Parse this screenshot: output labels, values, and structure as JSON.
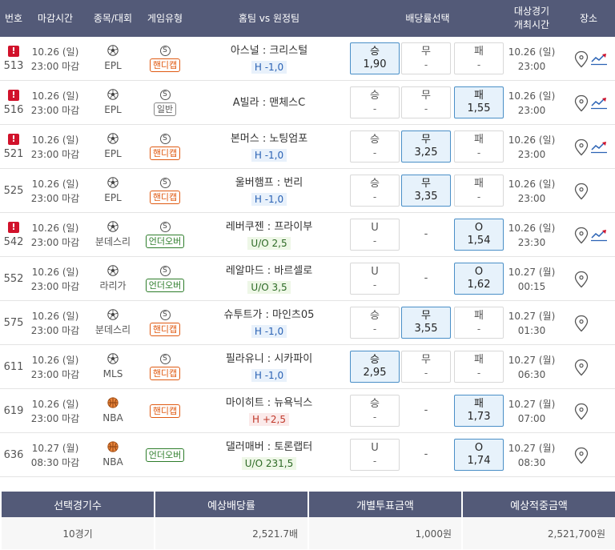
{
  "header": {
    "no": "번호",
    "deadline": "마감시간",
    "sport": "종목/대회",
    "game_type": "게임유형",
    "teams": "홈팀 vs 원정팀",
    "odds": "배당률선택",
    "date_line1": "대상경기",
    "date_line2": "개최시간",
    "place": "장소"
  },
  "rows": [
    {
      "no": "513",
      "alert": "!",
      "deadline1": "10.26 (일)",
      "deadline2": "23:00 마감",
      "sport": "EPL",
      "ball": "soccer",
      "s": "S",
      "tag": "핸디캡",
      "tag_type": "handi",
      "teams": "아스널 : 크리스털",
      "line": "H -1,0",
      "line_type": "h-minus",
      "o1": {
        "l": "승",
        "v": "1,90",
        "sel": true
      },
      "o2": {
        "l": "무",
        "v": "-",
        "sel": false
      },
      "o3": {
        "l": "패",
        "v": "-",
        "sel": false
      },
      "date1": "10.26 (일)",
      "date2": "23:00",
      "trend": true
    },
    {
      "no": "516",
      "alert": "!",
      "deadline1": "10.26 (일)",
      "deadline2": "23:00 마감",
      "sport": "EPL",
      "ball": "soccer",
      "s": "S",
      "tag": "일반",
      "tag_type": "normal",
      "teams": "A빌라 : 맨체스C",
      "line": "",
      "line_type": "",
      "o1": {
        "l": "승",
        "v": "-",
        "sel": false
      },
      "o2": {
        "l": "무",
        "v": "-",
        "sel": false
      },
      "o3": {
        "l": "패",
        "v": "1,55",
        "sel": true
      },
      "date1": "10.26 (일)",
      "date2": "23:00",
      "trend": true
    },
    {
      "no": "521",
      "alert": "!",
      "deadline1": "10.26 (일)",
      "deadline2": "23:00 마감",
      "sport": "EPL",
      "ball": "soccer",
      "s": "S",
      "tag": "핸디캡",
      "tag_type": "handi",
      "teams": "본머스 : 노팅엄포",
      "line": "H -1,0",
      "line_type": "h-minus",
      "o1": {
        "l": "승",
        "v": "-",
        "sel": false
      },
      "o2": {
        "l": "무",
        "v": "3,25",
        "sel": true
      },
      "o3": {
        "l": "패",
        "v": "-",
        "sel": false
      },
      "date1": "10.26 (일)",
      "date2": "23:00",
      "trend": true
    },
    {
      "no": "525",
      "alert": "",
      "deadline1": "10.26 (일)",
      "deadline2": "23:00 마감",
      "sport": "EPL",
      "ball": "soccer",
      "s": "S",
      "tag": "핸디캡",
      "tag_type": "handi",
      "teams": "울버햄프 : 번리",
      "line": "H -1,0",
      "line_type": "h-minus",
      "o1": {
        "l": "승",
        "v": "-",
        "sel": false
      },
      "o2": {
        "l": "무",
        "v": "3,35",
        "sel": true
      },
      "o3": {
        "l": "패",
        "v": "-",
        "sel": false
      },
      "date1": "10.26 (일)",
      "date2": "23:00",
      "trend": false
    },
    {
      "no": "542",
      "alert": "!",
      "deadline1": "10.26 (일)",
      "deadline2": "23:00 마감",
      "sport": "분데스리",
      "ball": "soccer",
      "s": "S",
      "tag": "언더오버",
      "tag_type": "uo",
      "teams": "레버쿠젠 : 프라이부",
      "line": "U/O 2,5",
      "line_type": "uo",
      "o1": {
        "l": "U",
        "v": "-",
        "sel": false
      },
      "o2": {
        "l": "-",
        "v": "",
        "sel": false,
        "blank": true
      },
      "o3": {
        "l": "O",
        "v": "1,54",
        "sel": true
      },
      "date1": "10.26 (일)",
      "date2": "23:30",
      "trend": true
    },
    {
      "no": "552",
      "alert": "",
      "deadline1": "10.26 (일)",
      "deadline2": "23:00 마감",
      "sport": "라리가",
      "ball": "soccer",
      "s": "S",
      "tag": "언더오버",
      "tag_type": "uo",
      "teams": "레알마드 : 바르셀로",
      "line": "U/O 3,5",
      "line_type": "uo",
      "o1": {
        "l": "U",
        "v": "-",
        "sel": false
      },
      "o2": {
        "l": "-",
        "v": "",
        "sel": false,
        "blank": true
      },
      "o3": {
        "l": "O",
        "v": "1,62",
        "sel": true
      },
      "date1": "10.27 (월)",
      "date2": "00:15",
      "trend": false
    },
    {
      "no": "575",
      "alert": "",
      "deadline1": "10.26 (일)",
      "deadline2": "23:00 마감",
      "sport": "분데스리",
      "ball": "soccer",
      "s": "S",
      "tag": "핸디캡",
      "tag_type": "handi",
      "teams": "슈투트가 : 마인츠05",
      "line": "H -1,0",
      "line_type": "h-minus",
      "o1": {
        "l": "승",
        "v": "-",
        "sel": false
      },
      "o2": {
        "l": "무",
        "v": "3,55",
        "sel": true
      },
      "o3": {
        "l": "패",
        "v": "-",
        "sel": false
      },
      "date1": "10.27 (월)",
      "date2": "01:30",
      "trend": false
    },
    {
      "no": "611",
      "alert": "",
      "deadline1": "10.26 (일)",
      "deadline2": "23:00 마감",
      "sport": "MLS",
      "ball": "soccer",
      "s": "S",
      "tag": "핸디캡",
      "tag_type": "handi",
      "teams": "필라유니 : 시카파이",
      "line": "H -1,0",
      "line_type": "h-minus",
      "o1": {
        "l": "승",
        "v": "2,95",
        "sel": true
      },
      "o2": {
        "l": "무",
        "v": "-",
        "sel": false
      },
      "o3": {
        "l": "패",
        "v": "-",
        "sel": false
      },
      "date1": "10.27 (월)",
      "date2": "06:30",
      "trend": false
    },
    {
      "no": "619",
      "alert": "",
      "deadline1": "10.26 (일)",
      "deadline2": "23:00 마감",
      "sport": "NBA",
      "ball": "basketball",
      "s": "",
      "tag": "핸디캡",
      "tag_type": "handi",
      "teams": "마이히트 : 뉴욕닉스",
      "line": "H +2,5",
      "line_type": "h-plus",
      "o1": {
        "l": "승",
        "v": "-",
        "sel": false
      },
      "o2": {
        "l": "-",
        "v": "",
        "sel": false,
        "blank": true
      },
      "o3": {
        "l": "패",
        "v": "1,73",
        "sel": true
      },
      "date1": "10.27 (월)",
      "date2": "07:00",
      "trend": false
    },
    {
      "no": "636",
      "alert": "",
      "deadline1": "10.27 (월)",
      "deadline2": "08:30 마감",
      "sport": "NBA",
      "ball": "basketball",
      "s": "",
      "tag": "언더오버",
      "tag_type": "uo",
      "teams": "댈러매버 : 토론랩터",
      "line": "U/O 231,5",
      "line_type": "uo",
      "o1": {
        "l": "U",
        "v": "-",
        "sel": false
      },
      "o2": {
        "l": "-",
        "v": "",
        "sel": false,
        "blank": true
      },
      "o3": {
        "l": "O",
        "v": "1,74",
        "sel": true
      },
      "date1": "10.27 (월)",
      "date2": "08:30",
      "trend": false
    }
  ],
  "summary": {
    "h1": "선택경기수",
    "h2": "예상배당률",
    "h3": "개별투표금액",
    "h4": "예상적중금액",
    "v1": "10경기",
    "v2": "2,521.7배",
    "v3": "1,000원",
    "v4": "2,521,700원"
  },
  "colors": {
    "header_bg": "#535a78",
    "selected_bg": "#e7f2fb",
    "selected_border": "#4a8fc7",
    "alert": "#d1122b",
    "handicap": "#e05a12",
    "under_over": "#2d7d2a"
  }
}
